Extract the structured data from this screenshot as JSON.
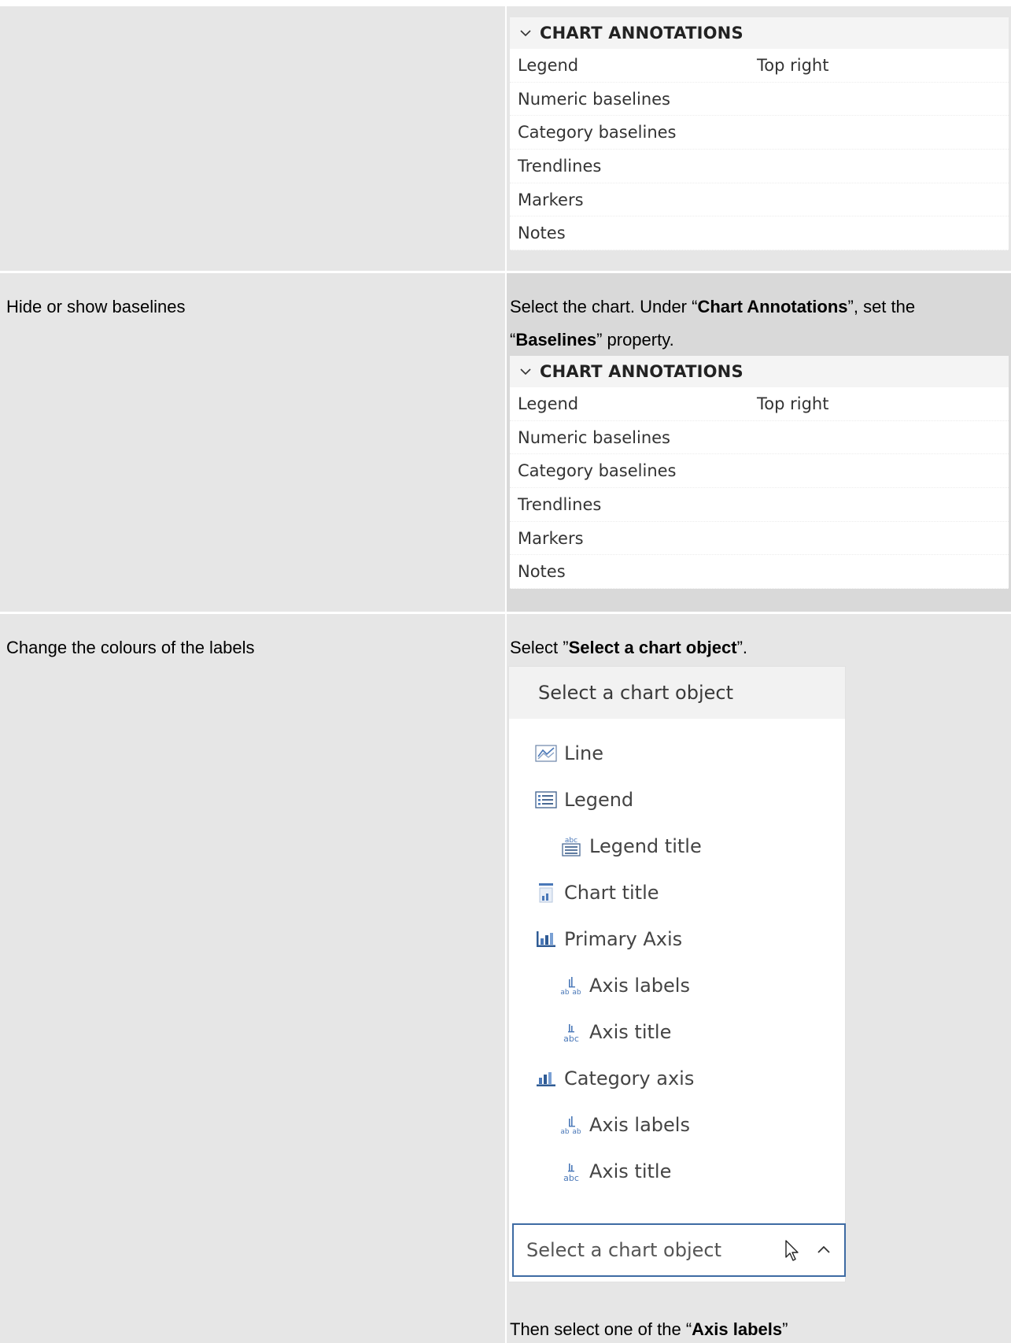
{
  "rows": [
    {
      "task": "",
      "panel": {
        "header": "CHART ANNOTATIONS",
        "props": [
          {
            "label": "Legend",
            "value": "Top right"
          },
          {
            "label": "Numeric baselines",
            "value": ""
          },
          {
            "label": "Category baselines",
            "value": ""
          },
          {
            "label": "Trendlines",
            "value": ""
          },
          {
            "label": "Markers",
            "value": ""
          },
          {
            "label": "Notes",
            "value": ""
          }
        ]
      }
    },
    {
      "task": "Hide or show baselines",
      "instruction": {
        "p1": "Select the chart. Under “",
        "b1": "Chart Annotations",
        "p2": "”, set the “",
        "b2": "Baselines",
        "p3": "” property."
      },
      "panel": {
        "header": "CHART ANNOTATIONS",
        "props": [
          {
            "label": "Legend",
            "value": "Top right"
          },
          {
            "label": "Numeric baselines",
            "value": ""
          },
          {
            "label": "Category baselines",
            "value": ""
          },
          {
            "label": "Trendlines",
            "value": ""
          },
          {
            "label": "Markers",
            "value": ""
          },
          {
            "label": "Notes",
            "value": ""
          }
        ]
      }
    },
    {
      "task": "Change the colours of the labels",
      "instruction": {
        "p1": "Select ”",
        "b1": "Select a chart object",
        "p2": "”."
      },
      "dropdown": {
        "header": "Select a chart object",
        "items": [
          {
            "label": "Line",
            "icon": "line-chart-icon"
          },
          {
            "label": "Legend",
            "icon": "legend-icon"
          },
          {
            "label": "Legend title",
            "icon": "legend-title-icon"
          },
          {
            "label": "Chart title",
            "icon": "chart-title-icon"
          },
          {
            "label": "Primary Axis",
            "icon": "primary-axis-icon"
          },
          {
            "label": "Axis labels",
            "icon": "axis-labels-icon"
          },
          {
            "label": "Axis title",
            "icon": "axis-title-icon"
          },
          {
            "label": "Category axis",
            "icon": "category-axis-icon"
          },
          {
            "label": "Axis labels",
            "icon": "axis-labels-icon"
          },
          {
            "label": "Axis title",
            "icon": "axis-title-icon"
          }
        ],
        "selected": "Select a chart object"
      },
      "followup": {
        "p1": "Then select one of the “",
        "b1": "Axis labels",
        "p2": "”"
      }
    }
  ],
  "colors": {
    "cell_bg": "#e6e6e6",
    "highlight_bg": "#d9d9d9",
    "icon_blue": "#4a78b8",
    "select_border": "#3e6ba3"
  }
}
